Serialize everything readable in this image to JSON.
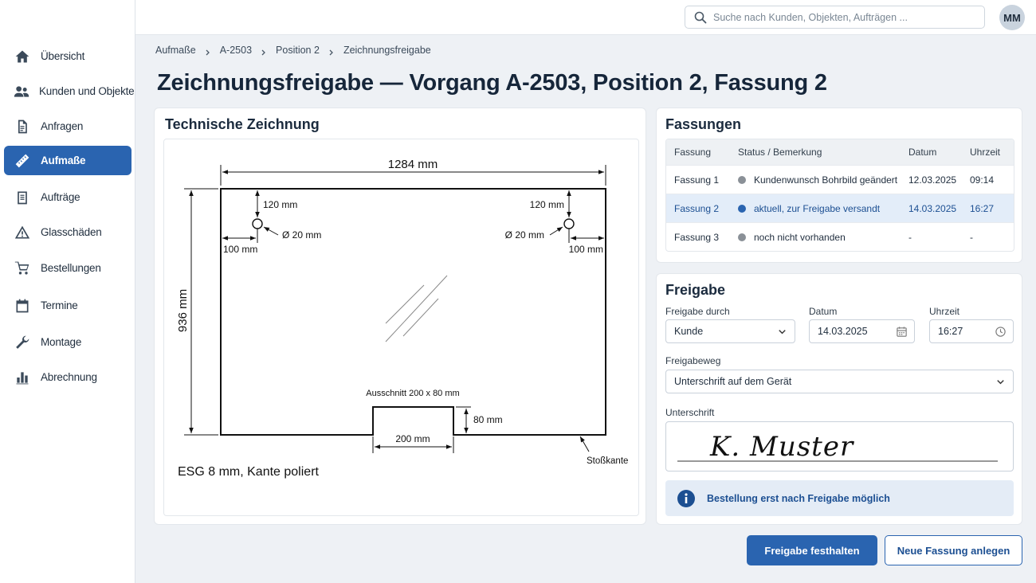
{
  "topbar": {
    "search_placeholder": "Suche nach Kunden, Objekten, Aufträgen ...",
    "avatar_initials": "MM"
  },
  "sidebar": {
    "items": [
      {
        "label": "Übersicht",
        "icon": "home-icon"
      },
      {
        "label": "Kunden und Objekte",
        "icon": "users-icon"
      },
      {
        "label": "Anfragen",
        "icon": "document-icon"
      },
      {
        "label": "Aufmaße",
        "icon": "ruler-icon",
        "active": true
      },
      {
        "label": "Aufträge",
        "icon": "clipboard-icon"
      },
      {
        "label": "Glasschäden",
        "icon": "warning-icon"
      },
      {
        "label": "Bestellungen",
        "icon": "cart-icon"
      },
      {
        "label": "Termine",
        "icon": "calendar-icon"
      },
      {
        "label": "Montage",
        "icon": "wrench-icon"
      },
      {
        "label": "Abrechnung",
        "icon": "bar-chart-icon"
      }
    ]
  },
  "breadcrumb": [
    "Aufmaße",
    "A-2503",
    "Position 2",
    "Zeichnungsfreigabe"
  ],
  "page_title": "Zeichnungsfreigabe — Vorgang A-2503, Position 2, Fassung 2",
  "drawing": {
    "title": "Technische Zeichnung",
    "width_label": "1284 mm",
    "height_label": "936 mm",
    "hole_left_top": "120 mm",
    "hole_right_top": "120 mm",
    "hole_left_diam": "Ø 20 mm",
    "hole_right_diam": "Ø 20 mm",
    "hole_left_side": "100 mm",
    "hole_right_side": "100 mm",
    "cutout_label": "Ausschnitt 200 x 80 mm",
    "cutout_height": "80 mm",
    "cutout_width": "200 mm",
    "edge_label": "Stoßkante",
    "material": "ESG 8 mm, Kante poliert"
  },
  "versions": {
    "title": "Fassungen",
    "headers": {
      "version": "Fassung",
      "status": "Status / Bemerkung",
      "date": "Datum",
      "time": "Uhrzeit"
    },
    "rows": [
      {
        "version": "Fassung 1",
        "status": "Kundenwunsch Bohrbild geändert",
        "date": "12.03.2025",
        "time": "09:14",
        "dot_color": "#8a9097"
      },
      {
        "version": "Fassung 2",
        "status": "aktuell, zur Freigabe versandt",
        "date": "14.03.2025",
        "time": "16:27",
        "dot_color": "#2a64b0"
      },
      {
        "version": "Fassung 3",
        "status": "noch nicht vorhanden",
        "date": "-",
        "time": "-",
        "dot_color": "#8a9097"
      }
    ]
  },
  "approval": {
    "title": "Freigabe",
    "by_label": "Freigabe durch",
    "by_value": "Kunde",
    "date_label": "Datum",
    "date_value": "14.03.2025",
    "time_label": "Uhrzeit",
    "time_value": "16:27",
    "method_label": "Freigabeweg",
    "method_value": "Unterschrift auf dem Gerät",
    "signature_label": "Unterschrift",
    "signature_text": "K. Muster",
    "info_text": "Bestellung erst nach Freigabe möglich"
  },
  "actions": {
    "primary": "Freigabe festhalten",
    "secondary": "Neue Fassung anlegen"
  },
  "colors": {
    "accent": "#2a64b0",
    "selected_row": "#e3edf9",
    "info_bg": "#e4ecf6"
  }
}
